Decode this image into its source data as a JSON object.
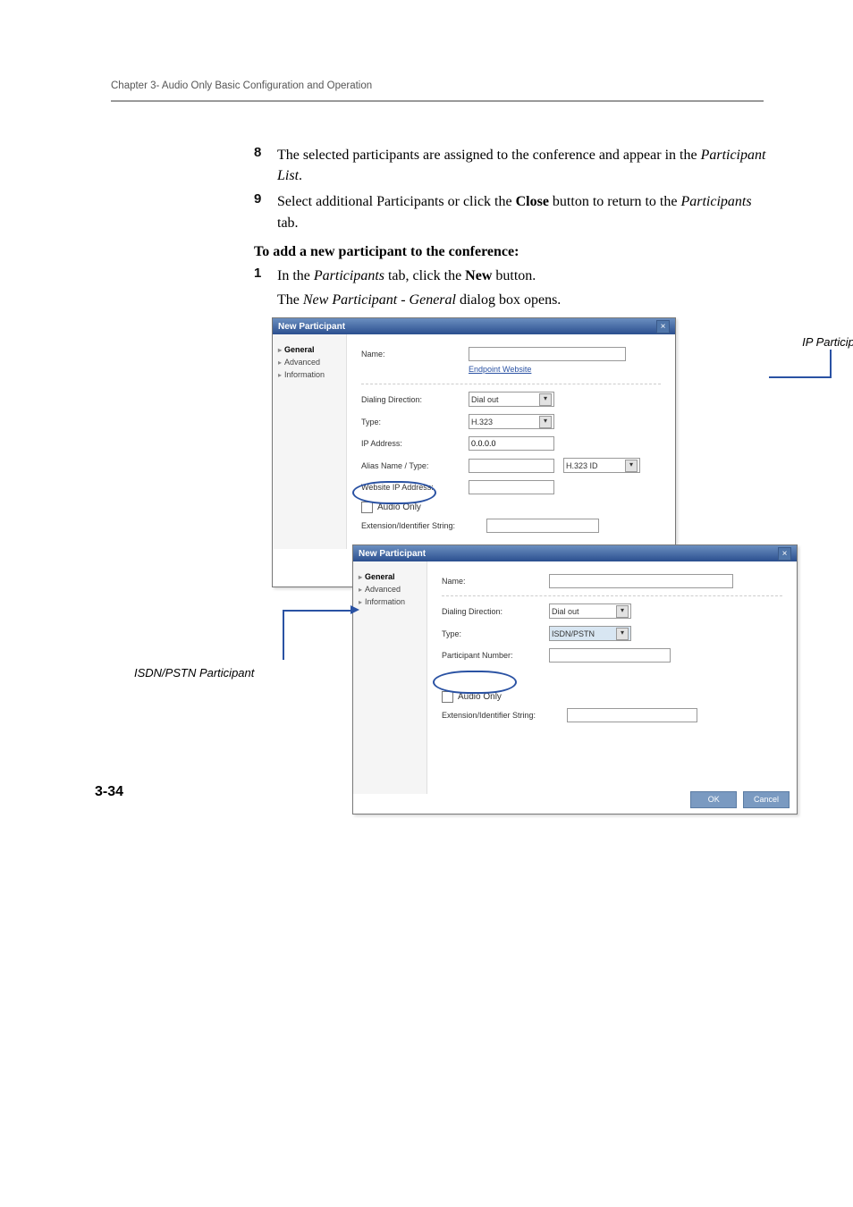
{
  "header": {
    "running": "Chapter 3- Audio Only Basic Configuration and Operation"
  },
  "footer": {
    "page": "3-34"
  },
  "steps": {
    "s8_num": "8",
    "s8_text_a": "The selected participants are assigned to the conference and appear in the ",
    "s8_text_it": "Participant List",
    "s8_text_b": ".",
    "s9_num": "9",
    "s9_text_a": "Select additional Participants or click the ",
    "s9_text_bold": "Close",
    "s9_text_b": " button to return to the ",
    "s9_text_it": "Participants",
    "s9_text_c": " tab."
  },
  "subhead": "To add a new participant to the conference:",
  "step1": {
    "num": "1",
    "a": "In the ",
    "it1": "Participants",
    "b": " tab, click the ",
    "bold": "New",
    "c": " button.",
    "para_a": "The ",
    "para_it": "New Participant - General",
    "para_b": " dialog box opens."
  },
  "callouts": {
    "ip": "IP Participant",
    "isdn": "ISDN/PSTN Participant"
  },
  "dlg1": {
    "title": "New Participant",
    "side": {
      "general": "General",
      "advanced": "Advanced",
      "information": "Information"
    },
    "name": "Name:",
    "endpoint": "Endpoint Website",
    "dialdir_label": "Dialing Direction:",
    "dialdir_value": "Dial out",
    "type_label": "Type:",
    "type_value": "H.323",
    "ip_label": "IP Address:",
    "ip_value": "0.0.0.0",
    "alias_label": "Alias Name / Type:",
    "alias_value": "H.323 ID",
    "website_label": "Website IP Address:",
    "audio_only": "Audio Only",
    "ext_label": "Extension/Identifier String:"
  },
  "dlg2": {
    "title": "New Participant",
    "side": {
      "general": "General",
      "advanced": "Advanced",
      "information": "Information"
    },
    "name": "Name:",
    "dialdir_label": "Dialing Direction:",
    "dialdir_value": "Dial out",
    "type_label": "Type:",
    "type_value": "ISDN/PSTN",
    "pn_label": "Participant Number:",
    "audio_only": "Audio Only",
    "ext_label": "Extension/Identifier String:",
    "ok": "OK",
    "cancel": "Cancel"
  }
}
